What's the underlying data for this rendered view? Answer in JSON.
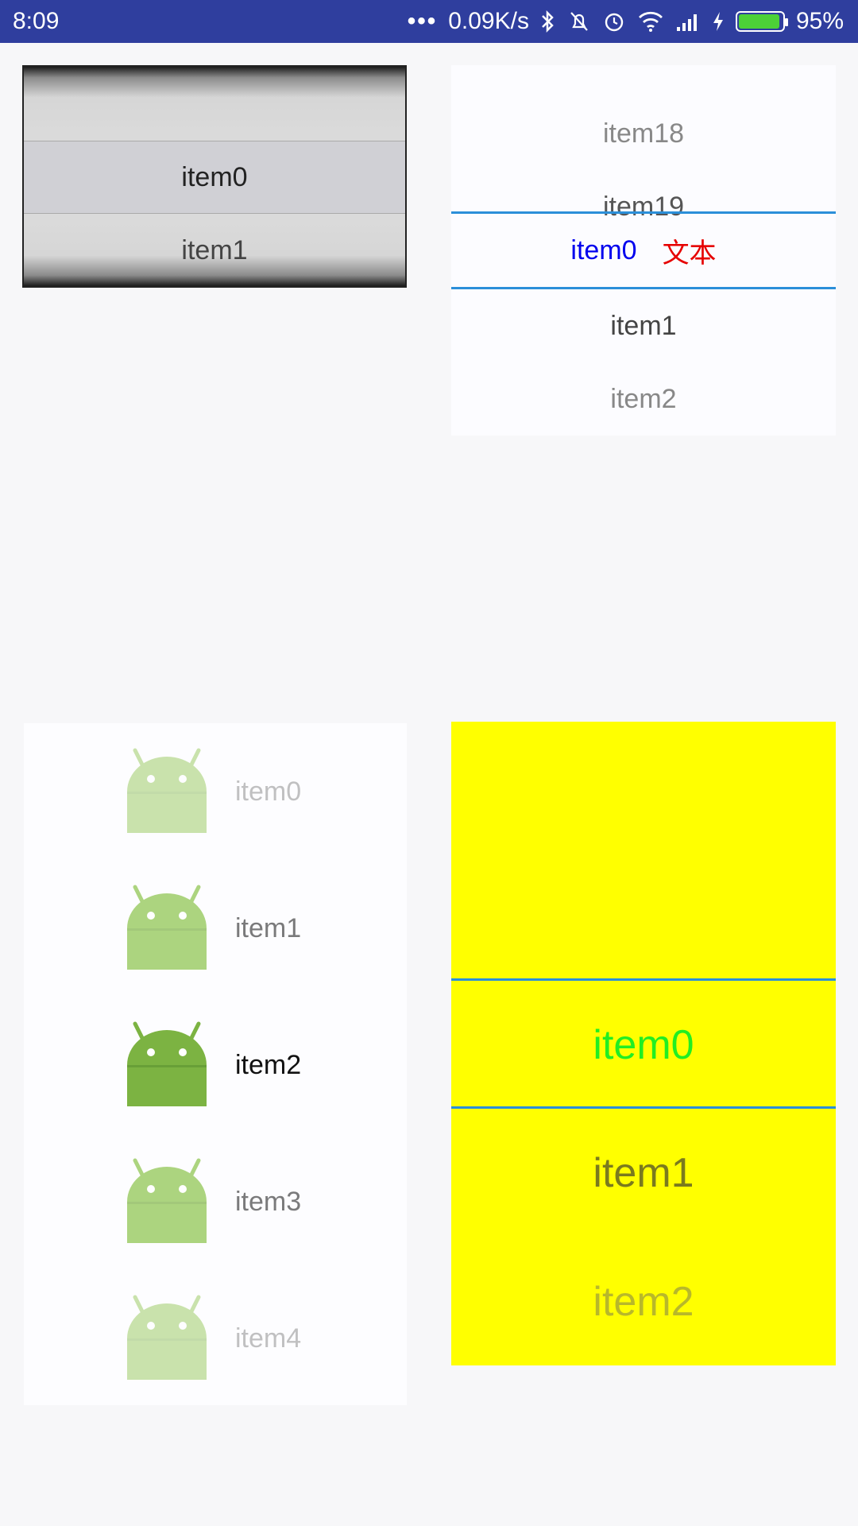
{
  "status_bar": {
    "time": "8:09",
    "dots": "•••",
    "net_speed": "0.09K/s",
    "battery_percent": "95%",
    "battery_level": 0.95,
    "icons": [
      "bluetooth-icon",
      "mute-icon",
      "alarm-icon",
      "wifi-icon",
      "signal-icon",
      "charging-icon",
      "battery-icon"
    ]
  },
  "wheel_ios": {
    "items": [
      "",
      "item0",
      "item1"
    ]
  },
  "wheel_right": {
    "items": [
      "item18",
      "item19",
      "item0",
      "item1",
      "item2"
    ],
    "selected_extra": "文本",
    "selected_color": "#0000ee",
    "extra_color": "#e60000"
  },
  "wheel_icons": {
    "items": [
      "item0",
      "item1",
      "item2",
      "item3",
      "item4"
    ],
    "icon": "android-icon"
  },
  "wheel_yellow": {
    "items": [
      "",
      "item0",
      "item1",
      "item2"
    ],
    "background": "#ffff00",
    "selected_color": "#22ee22"
  }
}
